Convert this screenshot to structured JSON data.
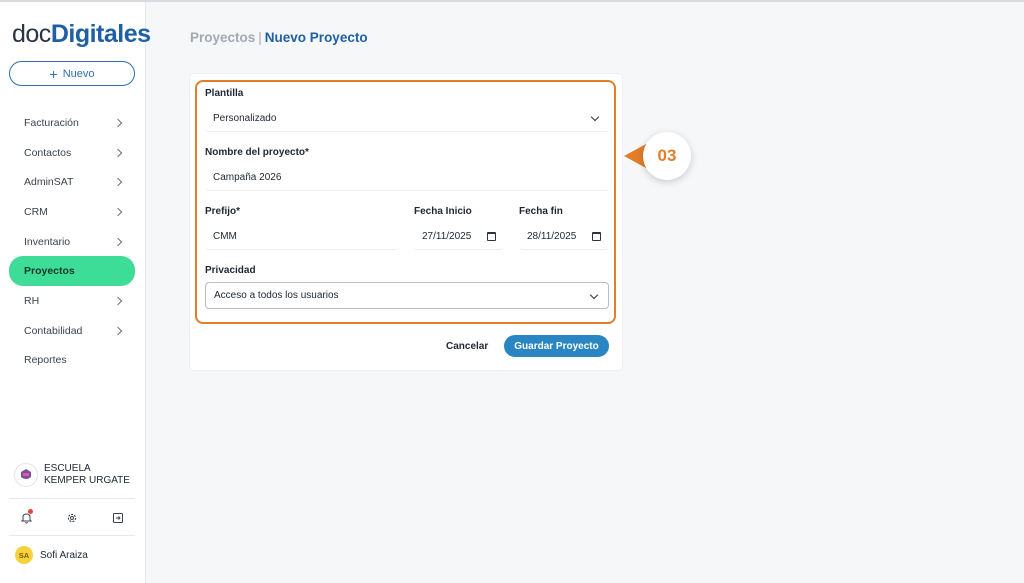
{
  "brand": {
    "part1": "doc",
    "part2": "Digitales"
  },
  "sidebar": {
    "new_label": "Nuevo",
    "items": [
      {
        "label": "Facturación",
        "has_chevron": true
      },
      {
        "label": "Contactos",
        "has_chevron": true
      },
      {
        "label": "AdminSAT",
        "has_chevron": true
      },
      {
        "label": "CRM",
        "has_chevron": true
      },
      {
        "label": "Inventario",
        "has_chevron": true
      },
      {
        "label": "Proyectos",
        "active": true
      },
      {
        "label": "RH",
        "has_chevron": true
      },
      {
        "label": "Contabilidad",
        "has_chevron": true
      },
      {
        "label": "Reportes"
      }
    ],
    "organization": "ESCUELA KEMPER URGATE",
    "user": {
      "initials": "SA",
      "name": "Sofi Araiza"
    }
  },
  "breadcrumb": {
    "parent": "Proyectos",
    "separator": "|",
    "current": "Nuevo Proyecto"
  },
  "form": {
    "template_label": "Plantilla",
    "template_value": "Personalizado",
    "name_label": "Nombre del proyecto*",
    "name_value": "Campaña 2026",
    "prefix_label": "Prefijo*",
    "prefix_value": "CMM",
    "start_label": "Fecha Inicio",
    "start_value": "27/11/2025",
    "end_label": "Fecha fin",
    "end_value": "28/11/2025",
    "privacy_label": "Privacidad",
    "privacy_value": "Acceso a todos los usuarios",
    "cancel_label": "Cancelar",
    "save_label": "Guardar Proyecto"
  },
  "step_badge": "03",
  "colors": {
    "accent": "#1f5fa6",
    "active_nav": "#3ddc97",
    "primary_button": "#2a86c2",
    "highlight": "#e27d2a"
  }
}
